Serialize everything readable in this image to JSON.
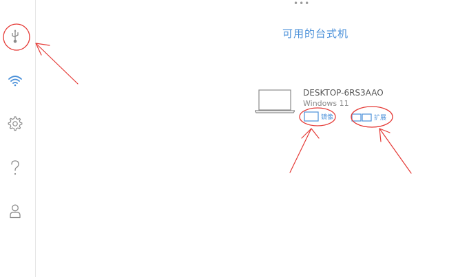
{
  "sidebar": {
    "items": [
      {
        "name": "usb",
        "icon": "usb-icon"
      },
      {
        "name": "wifi",
        "icon": "wifi-icon"
      },
      {
        "name": "settings",
        "icon": "gear-icon"
      },
      {
        "name": "help",
        "icon": "question-icon"
      },
      {
        "name": "account",
        "icon": "user-icon"
      }
    ]
  },
  "main": {
    "more_label": "•••",
    "title": "可用的台式机",
    "device": {
      "name": "DESKTOP-6RS3AAO",
      "os": "Windows 11",
      "mirror_label": "镜像",
      "extend_label": "扩展"
    }
  },
  "colors": {
    "accent": "#4a90d9",
    "annotation": "#e53935"
  }
}
